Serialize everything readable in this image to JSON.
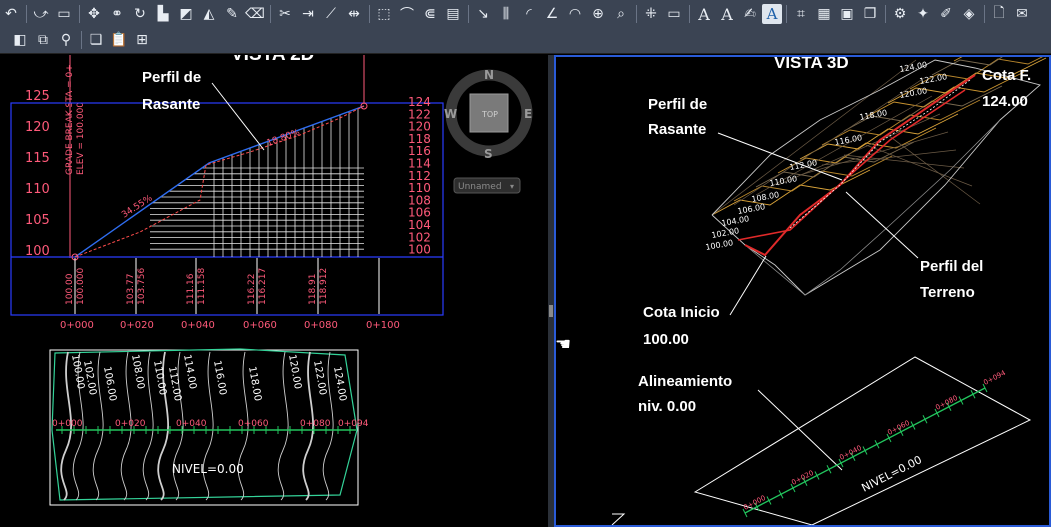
{
  "toolbar": {
    "row1_icons": [
      "undo-icon",
      "align-icon",
      "rectangle-icon",
      "move-icon",
      "array-icon",
      "rotate-icon",
      "align-left-icon",
      "stretch-icon",
      "mirror-icon",
      "pencil-icon",
      "eraser-icon",
      "scissors-icon",
      "extend-icon",
      "line-icon",
      "break-icon",
      "select-window-icon",
      "fillet-icon",
      "offset-icon",
      "properties-icon",
      "dimension-icon",
      "baseline-icon",
      "arc-icon",
      "angle-icon",
      "arc2-icon",
      "center-icon",
      "search-zoom-icon",
      "block-icon",
      "measure-icon",
      "text-a-icon",
      "text-a2-icon",
      "text-edit-icon",
      "text-highlight-icon",
      "crop-icon",
      "hatch-icon",
      "group-icon",
      "layers-icon",
      "purge-icon",
      "attribute-icon",
      "paint-icon",
      "isolate-icon",
      "document-icon",
      "annotate-icon"
    ],
    "row1_text": {
      "a1": "A",
      "a2": "A",
      "a3": "A"
    },
    "row2_icons": [
      "layer-icon",
      "layer-walk-icon",
      "layer-match-icon",
      "copy-icon",
      "paste-icon",
      "paste-xyz-icon"
    ]
  },
  "left": {
    "title": "VISTA 2D",
    "callout": [
      "Perfil de",
      "Rasante"
    ],
    "grade_label": "GRADE BREAK STA = 0+",
    "elev_label": "ELEV = 100.000",
    "left_axis": [
      "125",
      "120",
      "115",
      "110",
      "105",
      "100"
    ],
    "right_axis": [
      "124",
      "122",
      "120",
      "118",
      "116",
      "114",
      "112",
      "110",
      "108",
      "106",
      "104",
      "102",
      "100"
    ],
    "slopes": [
      "34.55%",
      "18.80%"
    ],
    "station_values": [
      {
        "a": "100.00",
        "b": "100.000"
      },
      {
        "a": "103.77",
        "b": "103.756"
      },
      {
        "a": "111.16",
        "b": "111.158"
      },
      {
        "a": "116.22",
        "b": "116.217"
      },
      {
        "a": "118.91",
        "b": "118.912"
      }
    ],
    "stations": [
      "0+000",
      "0+020",
      "0+040",
      "0+060",
      "0+080",
      "0+100"
    ],
    "compass": {
      "n": "N",
      "s": "S",
      "e": "E",
      "w": "W",
      "face": "TOP",
      "ucs": "Unnamed"
    },
    "plan": {
      "stations": [
        "0+000",
        "0+020",
        "0+040",
        "0+060",
        "0+080",
        "0+094"
      ],
      "contours": [
        "100.00",
        "102.00",
        "106.00",
        "108.00",
        "110.00",
        "112.00",
        "114.00",
        "116.00",
        "118.00",
        "120.00",
        "122.00",
        "124.00"
      ],
      "nivel": "NIVEL=0.00"
    }
  },
  "right": {
    "title": "VISTA 3D",
    "callouts": {
      "cota_f": [
        "Cota F.",
        "124.00"
      ],
      "perfil_rasante": [
        "Perfil de",
        "Rasante"
      ],
      "perfil_terreno": [
        "Perfil del",
        "Terreno"
      ],
      "cota_inicio": [
        "Cota Inicio",
        "100.00"
      ],
      "alineamiento": [
        "Alineamiento",
        "niv. 0.00"
      ]
    },
    "contours": [
      "124.00",
      "122.00",
      "120.00",
      "118.00",
      "116.00",
      "112.00",
      "110.00",
      "108.00",
      "106.00",
      "104.00",
      "102.00",
      "100.00"
    ],
    "stations": [
      "0+000",
      "0+020",
      "0+040",
      "0+060",
      "0+080",
      "0+094"
    ],
    "nivel": "NIVEL=0.00"
  },
  "colors": {
    "profile_blue": "#2f6df0",
    "profile_red": "#ff4d4d",
    "grid_white": "#ffffff",
    "contour_gray": "#d0d0d0",
    "alignment_green": "#22c55e",
    "boundary_green": "#34d399",
    "terrain_orange": "#d9a33a",
    "viewport_border": "#2a5bd7"
  }
}
